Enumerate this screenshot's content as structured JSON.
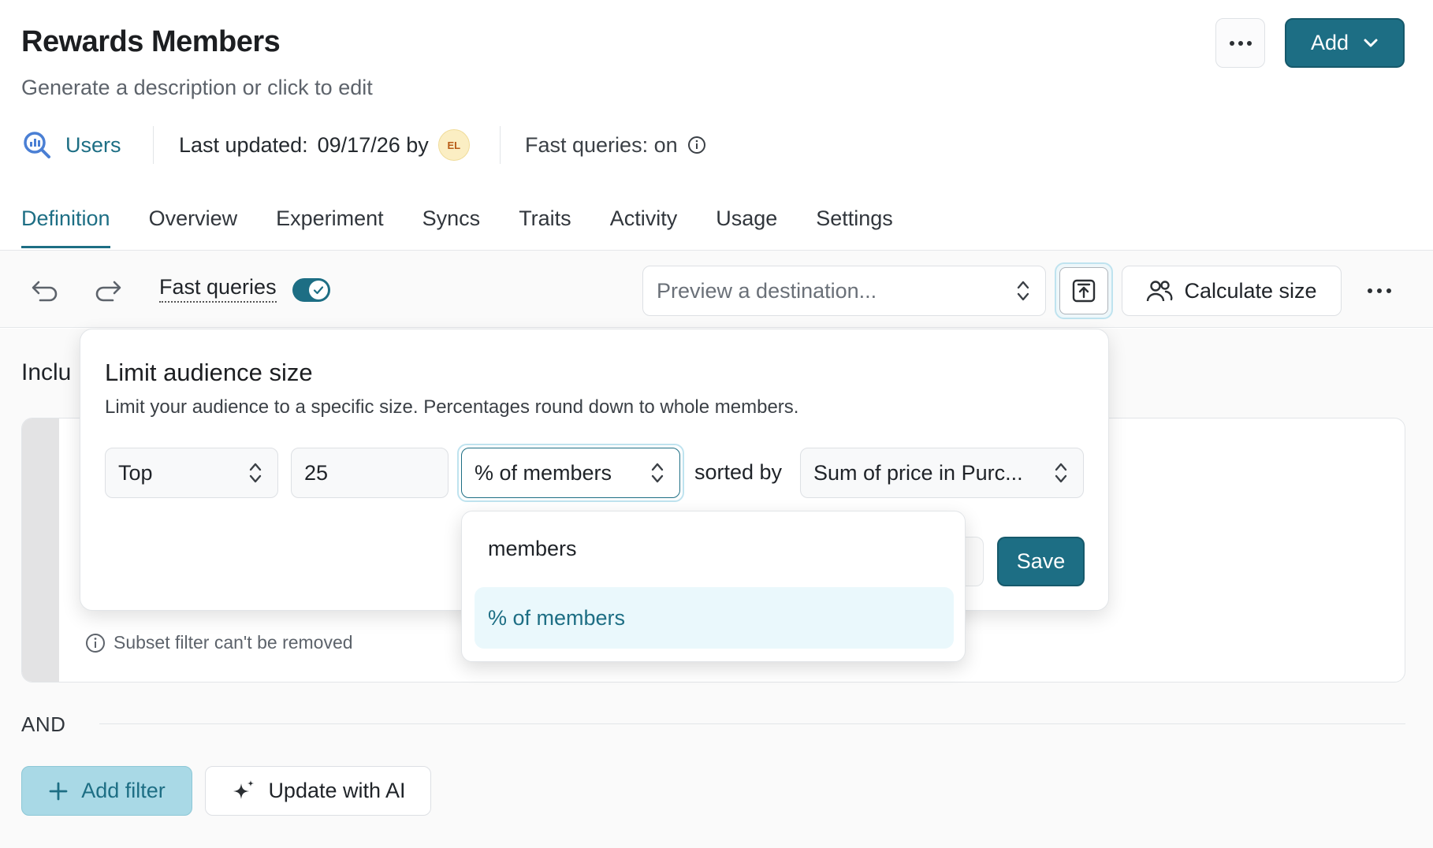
{
  "header": {
    "title": "Rewards Members",
    "subtitle": "Generate a description or click to edit",
    "add_label": "Add"
  },
  "meta": {
    "source_label": "Users",
    "last_updated_label": "Last updated:",
    "last_updated_value": "09/17/26 by",
    "avatar_initials": "EL",
    "fast_queries_status": "Fast queries: on"
  },
  "tabs": [
    {
      "label": "Definition",
      "active": true
    },
    {
      "label": "Overview"
    },
    {
      "label": "Experiment"
    },
    {
      "label": "Syncs"
    },
    {
      "label": "Traits"
    },
    {
      "label": "Activity"
    },
    {
      "label": "Usage"
    },
    {
      "label": "Settings"
    }
  ],
  "toolbar": {
    "fast_queries_label": "Fast queries",
    "fast_queries_enabled": true,
    "preview_placeholder": "Preview a destination...",
    "calculate_size_label": "Calculate size"
  },
  "content": {
    "include_label_partial": "Inclu",
    "subset_note": "Subset filter can't be removed",
    "and_label": "AND",
    "add_filter_label": "Add filter",
    "update_ai_label": "Update with AI"
  },
  "limit_popover": {
    "title": "Limit audience size",
    "description": "Limit your audience to a specific size. Percentages round down to whole members.",
    "direction_value": "Top",
    "amount_value": "25",
    "unit_value": "% of members",
    "sorted_by_label": "sorted by",
    "sort_value": "Sum of price in Purc...",
    "save_label": "Save"
  },
  "unit_dropdown": {
    "options": [
      "members",
      "% of members"
    ],
    "selected": "% of members"
  },
  "colors": {
    "accent": "#1d6e84",
    "accent_light": "#eaf8fc",
    "add_filter_bg": "#a9d9e6"
  }
}
